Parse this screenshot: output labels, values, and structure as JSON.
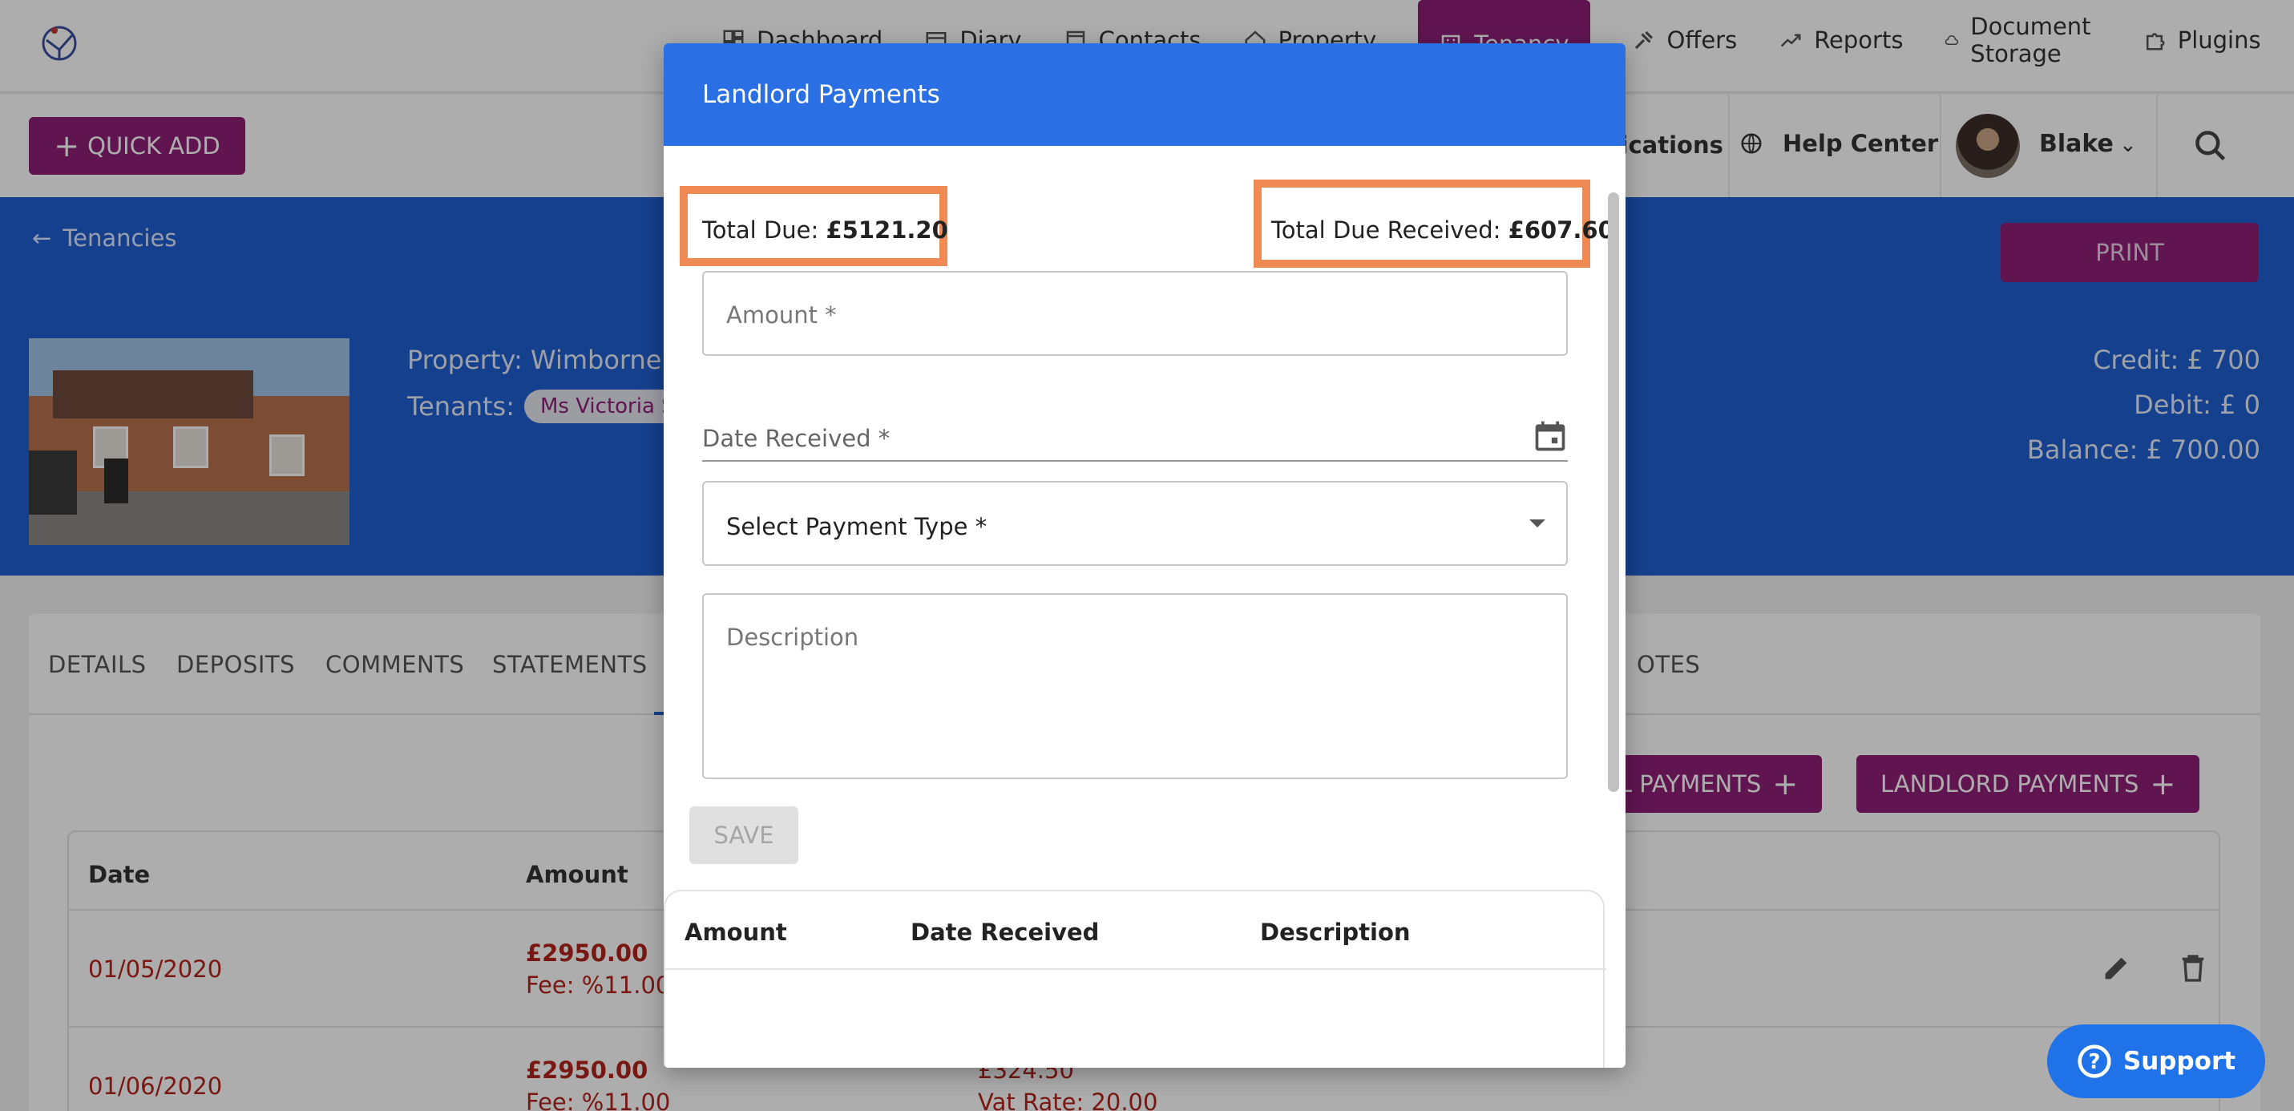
{
  "topnav": {
    "items": [
      {
        "label": "Dashboard",
        "icon": "dashboard-icon"
      },
      {
        "label": "Diary",
        "icon": "calendar-icon"
      },
      {
        "label": "Contacts",
        "icon": "contacts-icon"
      },
      {
        "label": "Property",
        "icon": "home-icon"
      },
      {
        "label": "Tenancy",
        "icon": "building-icon",
        "active": true
      },
      {
        "label": "Offers",
        "icon": "gavel-icon"
      },
      {
        "label": "Reports",
        "icon": "trend-icon"
      },
      {
        "label": "Document Storage",
        "icon": "cloud-icon"
      },
      {
        "label": "Plugins",
        "icon": "puzzle-icon"
      }
    ]
  },
  "subnav": {
    "quick_add": "QUICK ADD",
    "notifications": "fications",
    "help_center": "Help Center",
    "user_name": "Blake"
  },
  "hero": {
    "back_label": "Tenancies",
    "print_label": "PRINT",
    "property": "Property: Wimborne R",
    "tenants_label": "Tenants:",
    "tenant_chip": "Ms Victoria Sn",
    "credit": "Credit: £ 700",
    "debit": "Debit: £ 0",
    "balance": "Balance: £ 700.00"
  },
  "tabs": [
    "DETAILS",
    "DEPOSITS",
    "COMMENTS",
    "STATEMENTS",
    "OTES"
  ],
  "buttons": {
    "general_payments": "AL PAYMENTS",
    "landlord_payments": "LANDLORD PAYMENTS"
  },
  "bg_table": {
    "headers": [
      "Date",
      "Amount"
    ],
    "rows": [
      {
        "date": "01/05/2020",
        "amount": "£2950.00",
        "fee": "Fee: %11.00",
        "extra": "",
        "vat": ""
      },
      {
        "date": "01/06/2020",
        "amount": "£2950.00",
        "fee": "Fee: %11.00",
        "extra": "£324.50",
        "vat": "Vat Rate: 20.00"
      }
    ]
  },
  "support_label": "Support",
  "modal": {
    "title": "Landlord Payments",
    "total_due_label": "Total Due:",
    "total_due_value": "£5121.20",
    "total_received_label": "Total Due Received:",
    "total_received_value": "£607.60",
    "amount_label": "Amount *",
    "date_label": "Date Received *",
    "payment_type_label": "Select Payment Type *",
    "description_label": "Description",
    "save_label": "SAVE",
    "table_headers": [
      "Amount",
      "Date Received",
      "Description"
    ]
  },
  "colors": {
    "brand_purple": "#8e1f78",
    "hero_blue": "#1f5fd0",
    "modal_header_blue": "#2a6fe3",
    "highlight_orange": "#ef8a55",
    "negative_red": "#b3241b"
  }
}
